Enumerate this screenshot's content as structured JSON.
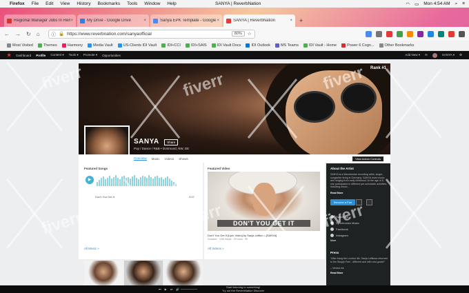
{
  "menubar": {
    "app": "Firefox",
    "items": [
      "File",
      "Edit",
      "View",
      "History",
      "Bookmarks",
      "Tools",
      "Window",
      "Help"
    ],
    "window_title": "SANYA | ReverbNation",
    "clock": "Mon 4:54 AM"
  },
  "tabs": [
    {
      "label": "Regional Manager Jobs In Rem...",
      "color": "#d9342b"
    },
    {
      "label": "My Drive - Google Drive",
      "color": "#3a7bd5"
    },
    {
      "label": "Sanya EPK Template - Google ...",
      "color": "#4a8af4"
    },
    {
      "label": "SANYA | ReverbNation",
      "color": "#e33b3b",
      "active": true
    }
  ],
  "toolbar": {
    "url": "https://www.reverbnation.com/sanyaofficial",
    "zoom": "80%"
  },
  "bookmarks": [
    {
      "label": "Most Visited",
      "color": "#888"
    },
    {
      "label": "Themes",
      "color": "#4caf50"
    },
    {
      "label": "Harmony",
      "color": "#e91e63"
    },
    {
      "label": "Media Vault",
      "color": "#2196f3"
    },
    {
      "label": "US-Clients IDI Vault",
      "color": "#2196f3"
    },
    {
      "label": "IDI+CCI",
      "color": "#4caf50"
    },
    {
      "label": "IDI+SAIS",
      "color": "#4caf50"
    },
    {
      "label": "IDI Vault Docs",
      "color": "#4caf50"
    },
    {
      "label": "IDI Outlook",
      "color": "#0078d4"
    },
    {
      "label": "MS Teams",
      "color": "#5b5fc7"
    },
    {
      "label": "IDI Vault - Home",
      "color": "#4caf50"
    },
    {
      "label": "Power 6 Cogn...",
      "color": "#d32f2f"
    },
    {
      "label": "Other Bookmarks",
      "color": "#888"
    }
  ],
  "rn_nav": {
    "logo": "★",
    "items": [
      "Dashboard",
      "Profile",
      "Content ▾",
      "Tools ▾",
      "Promote ▾",
      "Opportunities"
    ],
    "add_new": "Add New ▾",
    "user": "SANYA ▾"
  },
  "profile": {
    "rank": "Rank #1",
    "name": "SANYA",
    "share": "Share",
    "genre": "Pop / Dance / R&B • Dortmund, NW, DE",
    "tabs": [
      "Overview",
      "Music",
      "Videos",
      "Shows"
    ],
    "admin_button": "View Admin Controls"
  },
  "featured_songs": {
    "title": "Featured Songs",
    "song": "Don't You Get It",
    "duration": "3:47",
    "all_link": "All Music »"
  },
  "featured_video": {
    "title": "Featured Video",
    "overlay": "DON'T YOU GET IT",
    "video_title": "Don't You Get It [Lyric Video] by Sanja Leffkova [SANYA]",
    "meta": "Duration · 3:56  Views · 29  Likes · 95",
    "all_link": "All Videos »"
  },
  "about": {
    "title": "About the Artist",
    "bio": "SANYA is a Macedonian recording artist, singer-songwriter living in Germany. SANYA loved music and singing from early childhood. At the age of 5, she participated in different pre-scholastic activities, including music...",
    "read_more": "Read More",
    "become_fan": "Become a Fan",
    "links": [
      "Download",
      "Synchronize Music",
      "Facebook",
      "Instagram"
    ],
    "more": "More"
  },
  "press": {
    "title": "Press",
    "quote": "\"After living the London life, Sanja Leffkova returned to the Skopje Feel - different and with new goals!\"",
    "source": "– Vesina.mk",
    "read_more": "Read More"
  },
  "player": {
    "message_line1": "Start listening to something!",
    "message_line2": "Try out the ReverbNation Discover",
    "controls": [
      "⏮",
      "▶",
      "⏭",
      "🔊"
    ]
  },
  "watermark": "fiverr"
}
